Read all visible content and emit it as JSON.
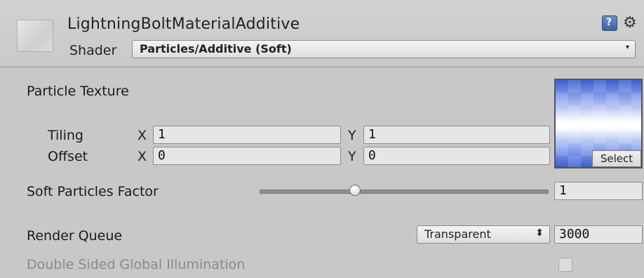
{
  "header": {
    "material_name": "LightningBoltMaterialAdditive",
    "shader_label": "Shader",
    "shader_value": "Particles/Additive (Soft)",
    "dropdown_arrow": "▾",
    "help_icon": "help-icon",
    "gear_icon": "gear-icon"
  },
  "texture": {
    "label": "Particle Texture",
    "select_label": "Select",
    "tiling": {
      "label": "Tiling",
      "x_label": "X",
      "x": "1",
      "y_label": "Y",
      "y": "1"
    },
    "offset": {
      "label": "Offset",
      "x_label": "X",
      "x": "0",
      "y_label": "Y",
      "y": "0"
    }
  },
  "soft_particles": {
    "label": "Soft Particles Factor",
    "value": "1",
    "slider_level": 0.33
  },
  "render_queue": {
    "label": "Render Queue",
    "mode": "Transparent",
    "updown": "⬍",
    "value": "3000"
  },
  "gi": {
    "label": "Double Sided Global Illumination",
    "checked": false
  }
}
